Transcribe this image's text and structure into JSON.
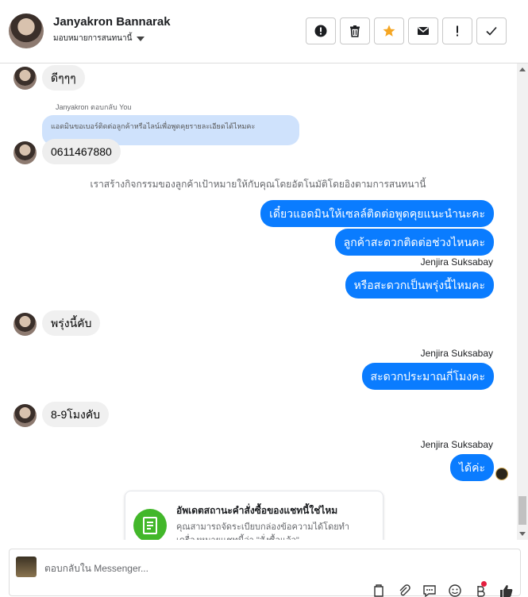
{
  "header": {
    "name": "Janyakron Bannarak",
    "assign_label": "มอบหมายการสนทนานี้"
  },
  "messages": {
    "m1": "ดีๆๆๆ",
    "reply_label": "Janyakron ตอบกลับ You",
    "quoted": "แอดมินขอเบอร์ติดต่อลูกค้าหรือไลน์เพื่อพูดคุยรายละเอียดได้ไหมคะ",
    "m2": "0611467880",
    "system_note": "เราสร้างกิจกรรมของลูกค้าเป้าหมายให้กับคุณโดยอัตโนมัติโดยอิงตามการสนทนานี้",
    "o1": "เดี๋ยวแอดมินให้เซลล์ติดต่อพูดคุยแนะนำนะคะ",
    "o2": "ลูกค้าสะดวกติดต่อช่วงไหนคะ",
    "sender1": "Jenjira Suksabay",
    "o3": "หรือสะดวกเป็นพรุ่งนี้ไหมคะ",
    "m3": "พรุ่งนี้คับ",
    "sender2": "Jenjira Suksabay",
    "o4": "สะดวกประมาณกี่โมงคะ",
    "m4": "8-9โมงคับ",
    "sender3": "Jenjira Suksabay",
    "o5": "ได้ค่ะ"
  },
  "card": {
    "title": "อัพเดตสถานะคำสั่งซื้อของแชทนี้ใช่ไหม",
    "desc": "คุณสามารถจัดระเบียบกล่องข้อความได้โดยทำเครื่องหมายแชทนี้ว่า \"สั่งซื้อแล้ว\""
  },
  "composer": {
    "placeholder": "ตอบกลับใน Messenger..."
  },
  "colors": {
    "outgoing": "#0a7cff",
    "incoming": "#f0f0f0",
    "quoted": "#cfe2fc",
    "accent_star": "#f5a623"
  },
  "icons": [
    "spam-icon",
    "trash-icon",
    "star-icon",
    "envelope-icon",
    "exclamation-icon",
    "check-icon"
  ]
}
